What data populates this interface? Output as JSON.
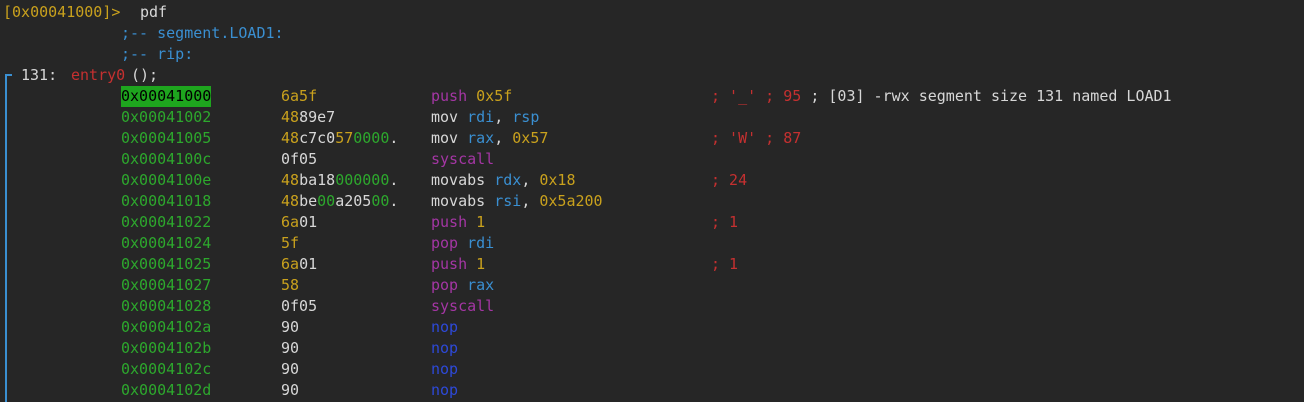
{
  "prompt": {
    "address": "[0x00041000]>",
    "command": "pdf"
  },
  "labels": [
    {
      "text": ";-- segment.LOAD1:"
    },
    {
      "text": ";-- rip:"
    }
  ],
  "function": {
    "size": "131:",
    "name": "entry0",
    "args": "();"
  },
  "colors": {
    "background": "#262626",
    "address": "#2da82d",
    "highlight": "#1ea51e",
    "bytes_yellow": "#c9a11d",
    "register": "#3a8fd1",
    "purple_mnemonic": "#a436a4",
    "nop": "#2d49d9",
    "comment_red": "#c53030"
  },
  "rows": [
    {
      "addr": "0x00041000",
      "bytes": [
        {
          "t": "6a5f",
          "c": "yellow"
        }
      ],
      "op": [
        {
          "t": "push ",
          "c": "purple"
        },
        {
          "t": "0x5f",
          "c": "yellow"
        }
      ],
      "comment": [
        {
          "t": "; '_' ; 95",
          "c": "red"
        },
        {
          "t": " ; [03] -rwx segment size 131 named LOAD1",
          "c": "white"
        }
      ]
    },
    {
      "addr": "0x00041002",
      "bytes": [
        {
          "t": "48",
          "c": "yellow"
        },
        {
          "t": "89e7",
          "c": "white"
        }
      ],
      "op": [
        {
          "t": "mov ",
          "c": "white"
        },
        {
          "t": "rdi",
          "c": "blue"
        },
        {
          "t": ", ",
          "c": "white"
        },
        {
          "t": "rsp",
          "c": "blue"
        }
      ],
      "comment": []
    },
    {
      "addr": "0x00041005",
      "bytes": [
        {
          "t": "48",
          "c": "yellow"
        },
        {
          "t": "c7c0",
          "c": "white"
        },
        {
          "t": "57",
          "c": "yellow"
        },
        {
          "t": "0000",
          "c": "green"
        },
        {
          "t": ".",
          "c": "white"
        }
      ],
      "op": [
        {
          "t": "mov ",
          "c": "white"
        },
        {
          "t": "rax",
          "c": "blue"
        },
        {
          "t": ", ",
          "c": "white"
        },
        {
          "t": "0x57",
          "c": "yellow"
        }
      ],
      "comment": [
        {
          "t": "; 'W' ; 87",
          "c": "red"
        }
      ]
    },
    {
      "addr": "0x0004100c",
      "bytes": [
        {
          "t": "0f05",
          "c": "white"
        }
      ],
      "op": [
        {
          "t": "syscall",
          "c": "purple"
        }
      ],
      "comment": []
    },
    {
      "addr": "0x0004100e",
      "bytes": [
        {
          "t": "48",
          "c": "yellow"
        },
        {
          "t": "ba18",
          "c": "white"
        },
        {
          "t": "000000",
          "c": "green"
        },
        {
          "t": ".",
          "c": "white"
        }
      ],
      "op": [
        {
          "t": "movabs ",
          "c": "white"
        },
        {
          "t": "rdx",
          "c": "blue"
        },
        {
          "t": ", ",
          "c": "white"
        },
        {
          "t": "0x18",
          "c": "yellow"
        }
      ],
      "comment": [
        {
          "t": "; 24",
          "c": "red"
        }
      ]
    },
    {
      "addr": "0x00041018",
      "bytes": [
        {
          "t": "48",
          "c": "yellow"
        },
        {
          "t": "be",
          "c": "white"
        },
        {
          "t": "00",
          "c": "green"
        },
        {
          "t": "a205",
          "c": "white"
        },
        {
          "t": "00",
          "c": "green"
        },
        {
          "t": ".",
          "c": "white"
        }
      ],
      "op": [
        {
          "t": "movabs ",
          "c": "white"
        },
        {
          "t": "rsi",
          "c": "blue"
        },
        {
          "t": ", ",
          "c": "white"
        },
        {
          "t": "0x5a200",
          "c": "yellow"
        }
      ],
      "comment": []
    },
    {
      "addr": "0x00041022",
      "bytes": [
        {
          "t": "6a",
          "c": "yellow"
        },
        {
          "t": "01",
          "c": "white"
        }
      ],
      "op": [
        {
          "t": "push ",
          "c": "purple"
        },
        {
          "t": "1",
          "c": "yellow"
        }
      ],
      "comment": [
        {
          "t": "; 1",
          "c": "red"
        }
      ]
    },
    {
      "addr": "0x00041024",
      "bytes": [
        {
          "t": "5f",
          "c": "yellow"
        }
      ],
      "op": [
        {
          "t": "pop ",
          "c": "purple"
        },
        {
          "t": "rdi",
          "c": "blue"
        }
      ],
      "comment": []
    },
    {
      "addr": "0x00041025",
      "bytes": [
        {
          "t": "6a",
          "c": "yellow"
        },
        {
          "t": "01",
          "c": "white"
        }
      ],
      "op": [
        {
          "t": "push ",
          "c": "purple"
        },
        {
          "t": "1",
          "c": "yellow"
        }
      ],
      "comment": [
        {
          "t": "; 1",
          "c": "red"
        }
      ]
    },
    {
      "addr": "0x00041027",
      "bytes": [
        {
          "t": "58",
          "c": "yellow"
        }
      ],
      "op": [
        {
          "t": "pop ",
          "c": "purple"
        },
        {
          "t": "rax",
          "c": "blue"
        }
      ],
      "comment": []
    },
    {
      "addr": "0x00041028",
      "bytes": [
        {
          "t": "0f05",
          "c": "white"
        }
      ],
      "op": [
        {
          "t": "syscall",
          "c": "purple"
        }
      ],
      "comment": []
    },
    {
      "addr": "0x0004102a",
      "bytes": [
        {
          "t": "90",
          "c": "white"
        }
      ],
      "op": [
        {
          "t": "nop",
          "c": "nop"
        }
      ],
      "comment": []
    },
    {
      "addr": "0x0004102b",
      "bytes": [
        {
          "t": "90",
          "c": "white"
        }
      ],
      "op": [
        {
          "t": "nop",
          "c": "nop"
        }
      ],
      "comment": []
    },
    {
      "addr": "0x0004102c",
      "bytes": [
        {
          "t": "90",
          "c": "white"
        }
      ],
      "op": [
        {
          "t": "nop",
          "c": "nop"
        }
      ],
      "comment": []
    },
    {
      "addr": "0x0004102d",
      "bytes": [
        {
          "t": "90",
          "c": "white"
        }
      ],
      "op": [
        {
          "t": "nop",
          "c": "nop"
        }
      ],
      "comment": []
    }
  ]
}
